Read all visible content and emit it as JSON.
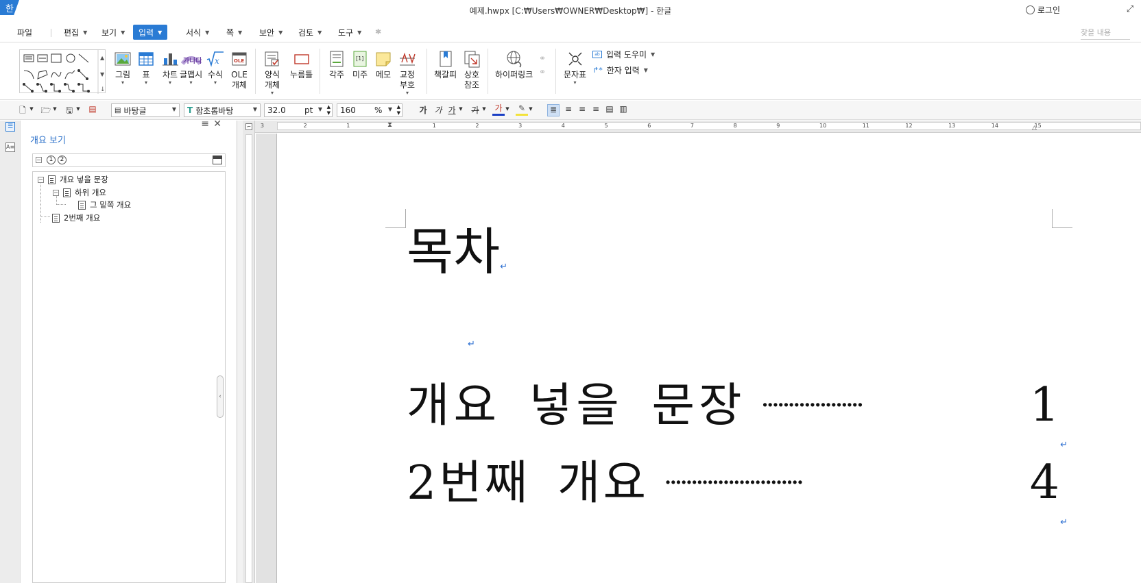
{
  "app": {
    "logo": "한",
    "title": "예제.hwpx [C:₩Users₩OWNER₩Desktop₩] - 한글",
    "login": "로그인",
    "maximize": "⤢"
  },
  "menubar": {
    "items": [
      {
        "label": "파일"
      },
      {
        "label": "편집"
      },
      {
        "label": "보기"
      },
      {
        "label": "입력"
      },
      {
        "label": "서식"
      },
      {
        "label": "쪽"
      },
      {
        "label": "보안"
      },
      {
        "label": "검토"
      },
      {
        "label": "도구"
      }
    ],
    "active": "입력",
    "search_placeholder": "찾을 내용"
  },
  "ribbon": {
    "buttons": [
      {
        "label": "그림",
        "icon": "image-icon"
      },
      {
        "label": "표",
        "icon": "table-icon"
      },
      {
        "label": "차트",
        "icon": "chart-icon"
      },
      {
        "label": "글맵시",
        "icon": "wordart-icon"
      },
      {
        "label": "수식",
        "icon": "formula-icon"
      },
      {
        "label": "OLE\n개체",
        "icon": "ole-icon"
      },
      {
        "label": "양식\n개체",
        "icon": "form-icon"
      },
      {
        "label": "누름틀",
        "icon": "field-icon"
      },
      {
        "label": "각주",
        "icon": "footnote-icon"
      },
      {
        "label": "미주",
        "icon": "endnote-icon"
      },
      {
        "label": "메모",
        "icon": "memo-icon"
      },
      {
        "label": "교정\n부호",
        "icon": "proof-icon"
      },
      {
        "label": "책갈피",
        "icon": "bookmark-icon"
      },
      {
        "label": "상호\n참조",
        "icon": "crossref-icon"
      },
      {
        "label": "하이퍼링크",
        "icon": "hyperlink-icon"
      },
      {
        "label": "문자표",
        "icon": "symbol-icon"
      }
    ],
    "input_helper": "입력 도우미",
    "hanja_input": "한자 입력"
  },
  "toolbar": {
    "style": "바탕글",
    "font": "함초롬바탕",
    "size": "32.0",
    "size_unit": "pt",
    "line_spacing": "160",
    "line_spacing_unit": "%",
    "bold": "가",
    "italic": "가",
    "underline": "가",
    "strike": "가",
    "font_color": "가"
  },
  "outline_panel": {
    "title": "개요 보기",
    "levels": [
      "1",
      "2"
    ],
    "nodes": [
      {
        "label": "개요 넣을 문장",
        "level": 0
      },
      {
        "label": "하위 개요",
        "level": 1
      },
      {
        "label": "그 밑쪽 개요",
        "level": 2
      },
      {
        "label": "2번째 개요",
        "level": 0
      }
    ]
  },
  "ruler": {
    "marks": [
      "3",
      "2",
      "1",
      "1",
      "2",
      "3",
      "4",
      "5",
      "6",
      "7",
      "8",
      "9",
      "10",
      "11",
      "12",
      "13",
      "14",
      "15"
    ]
  },
  "document": {
    "heading": "목차",
    "toc": [
      {
        "text": "개요 넣을 문장",
        "leader": "···················",
        "page": "1"
      },
      {
        "text": "2번째 개요",
        "leader": "··························",
        "page": "4"
      }
    ],
    "return_mark": "↵"
  }
}
